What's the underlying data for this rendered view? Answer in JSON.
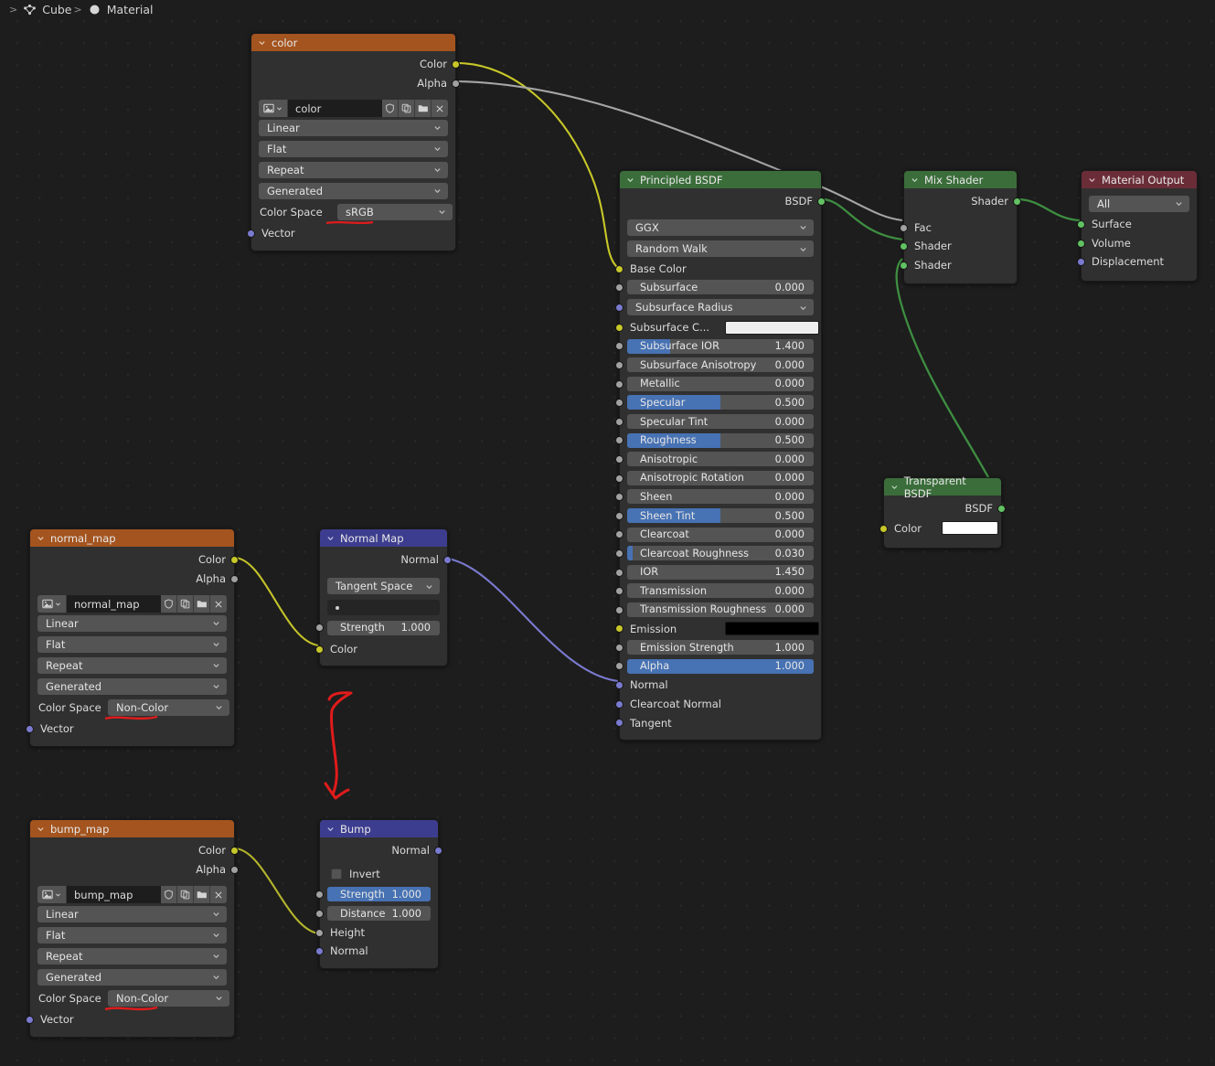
{
  "app": "blender-shader-node-editor",
  "breadcrumb": {
    "items": [
      {
        "icon": "mesh-triangle-icon",
        "label": "Cube"
      },
      {
        "icon": "material-sphere-icon",
        "label": "Material"
      }
    ],
    "separator": ">"
  },
  "colors": {
    "background": "#1d1d1d",
    "node_body": "#303030",
    "header_texture": "#a3541f",
    "header_shader": "#3b6d3b",
    "header_output": "#6a2d38",
    "header_vector": "#3d3d8f",
    "slider_fill": "#4772b3",
    "widget": "#545454",
    "socket_color": "#c7c729",
    "socket_value": "#a1a1a1",
    "socket_shader": "#62c263",
    "socket_vector": "#7a7ad0",
    "wire_color": "#c7c729",
    "wire_value": "#a1a1a1",
    "wire_shader": "#3e8e41",
    "wire_vector": "#7a7ad0",
    "annotation_red": "#e01b1b"
  },
  "nodes": {
    "color_tex": {
      "title": "color",
      "outputs": [
        "Color",
        "Alpha"
      ],
      "image_name": "color",
      "dropdowns": [
        "Linear",
        "Flat",
        "Repeat",
        "Generated"
      ],
      "color_space_label": "Color Space",
      "color_space_value": "sRGB",
      "color_space_annotated": true,
      "inputs": [
        "Vector"
      ],
      "tool_icons": [
        "image-icon",
        "chevron-down-icon",
        "shield-icon",
        "copy-icon",
        "folder-icon",
        "close-icon"
      ]
    },
    "normal_map_tex": {
      "title": "normal_map",
      "outputs": [
        "Color",
        "Alpha"
      ],
      "image_name": "normal_map",
      "dropdowns": [
        "Linear",
        "Flat",
        "Repeat",
        "Generated"
      ],
      "color_space_label": "Color Space",
      "color_space_value": "Non-Color",
      "color_space_annotated": true,
      "inputs": [
        "Vector"
      ],
      "tool_icons": [
        "image-icon",
        "chevron-down-icon",
        "shield-icon",
        "copy-icon",
        "folder-icon",
        "close-icon"
      ]
    },
    "bump_map_tex": {
      "title": "bump_map",
      "outputs": [
        "Color",
        "Alpha"
      ],
      "image_name": "bump_map",
      "dropdowns": [
        "Linear",
        "Flat",
        "Repeat",
        "Generated"
      ],
      "color_space_label": "Color Space",
      "color_space_value": "Non-Color",
      "color_space_annotated": true,
      "inputs": [
        "Vector"
      ],
      "tool_icons": [
        "image-icon",
        "chevron-down-icon",
        "shield-icon",
        "copy-icon",
        "folder-icon",
        "close-icon"
      ]
    },
    "normal_map_node": {
      "title": "Normal Map",
      "outputs": [
        "Normal"
      ],
      "space": "Tangent Space",
      "uv_map": "",
      "strength": {
        "label": "Strength",
        "value": "1.000",
        "fill_pct": 0
      },
      "inputs": [
        "Color"
      ]
    },
    "bump_node": {
      "title": "Bump",
      "outputs": [
        "Normal"
      ],
      "invert": {
        "label": "Invert",
        "checked": false
      },
      "strength": {
        "label": "Strength",
        "value": "1.000",
        "fill_pct": 100
      },
      "distance": {
        "label": "Distance",
        "value": "1.000",
        "fill_pct": 0
      },
      "inputs": [
        "Height",
        "Normal"
      ]
    },
    "principled": {
      "title": "Principled BSDF",
      "outputs": [
        "BSDF"
      ],
      "distribution": "GGX",
      "subsurface_method": "Random Walk",
      "inputs": [
        {
          "label": "Base Color",
          "type": "color",
          "socket": "yellow"
        },
        {
          "label": "Subsurface",
          "type": "slider",
          "value": "0.000",
          "fill_pct": 0,
          "socket": "gray"
        },
        {
          "label": "Subsurface Radius",
          "type": "dropdown",
          "socket": "purple"
        },
        {
          "label": "Subsurface C...",
          "type": "swatch",
          "swatch_color": "#efefef",
          "socket": "yellow"
        },
        {
          "label": "Subsurface IOR",
          "type": "slider",
          "value": "1.400",
          "fill_pct": 23,
          "socket": "gray"
        },
        {
          "label": "Subsurface Anisotropy",
          "type": "slider",
          "value": "0.000",
          "fill_pct": 0,
          "socket": "gray"
        },
        {
          "label": "Metallic",
          "type": "slider",
          "value": "0.000",
          "fill_pct": 0,
          "socket": "gray"
        },
        {
          "label": "Specular",
          "type": "slider",
          "value": "0.500",
          "fill_pct": 50,
          "socket": "gray"
        },
        {
          "label": "Specular Tint",
          "type": "slider",
          "value": "0.000",
          "fill_pct": 0,
          "socket": "gray"
        },
        {
          "label": "Roughness",
          "type": "slider",
          "value": "0.500",
          "fill_pct": 50,
          "socket": "gray"
        },
        {
          "label": "Anisotropic",
          "type": "slider",
          "value": "0.000",
          "fill_pct": 0,
          "socket": "gray"
        },
        {
          "label": "Anisotropic Rotation",
          "type": "slider",
          "value": "0.000",
          "fill_pct": 0,
          "socket": "gray"
        },
        {
          "label": "Sheen",
          "type": "slider",
          "value": "0.000",
          "fill_pct": 0,
          "socket": "gray"
        },
        {
          "label": "Sheen Tint",
          "type": "slider",
          "value": "0.500",
          "fill_pct": 50,
          "socket": "gray"
        },
        {
          "label": "Clearcoat",
          "type": "slider",
          "value": "0.000",
          "fill_pct": 0,
          "socket": "gray"
        },
        {
          "label": "Clearcoat Roughness",
          "type": "slider",
          "value": "0.030",
          "fill_pct": 3,
          "socket": "gray"
        },
        {
          "label": "IOR",
          "type": "slider",
          "value": "1.450",
          "fill_pct": 0,
          "socket": "gray"
        },
        {
          "label": "Transmission",
          "type": "slider",
          "value": "0.000",
          "fill_pct": 0,
          "socket": "gray"
        },
        {
          "label": "Transmission Roughness",
          "type": "slider",
          "value": "0.000",
          "fill_pct": 0,
          "socket": "gray"
        },
        {
          "label": "Emission",
          "type": "swatch",
          "swatch_color": "#000000",
          "socket": "yellow"
        },
        {
          "label": "Emission Strength",
          "type": "slider",
          "value": "1.000",
          "fill_pct": 0,
          "socket": "gray"
        },
        {
          "label": "Alpha",
          "type": "slider",
          "value": "1.000",
          "fill_pct": 100,
          "socket": "gray"
        },
        {
          "label": "Normal",
          "type": "plain",
          "socket": "purple"
        },
        {
          "label": "Clearcoat Normal",
          "type": "plain",
          "socket": "purple"
        },
        {
          "label": "Tangent",
          "type": "plain",
          "socket": "purple"
        }
      ]
    },
    "mix_shader": {
      "title": "Mix Shader",
      "outputs": [
        "Shader"
      ],
      "inputs": [
        "Fac",
        "Shader",
        "Shader"
      ]
    },
    "transparent_bsdf": {
      "title": "Transparent BSDF",
      "outputs": [
        "BSDF"
      ],
      "color_label": "Color",
      "color_value": "#ffffff"
    },
    "material_output": {
      "title": "Material Output",
      "target": "All",
      "inputs": [
        "Surface",
        "Volume",
        "Displacement"
      ]
    }
  },
  "annotations": {
    "arrow": "red-hand-drawn-down-arrow",
    "underlines": [
      "sRGB",
      "Non-Color",
      "Non-Color"
    ]
  }
}
